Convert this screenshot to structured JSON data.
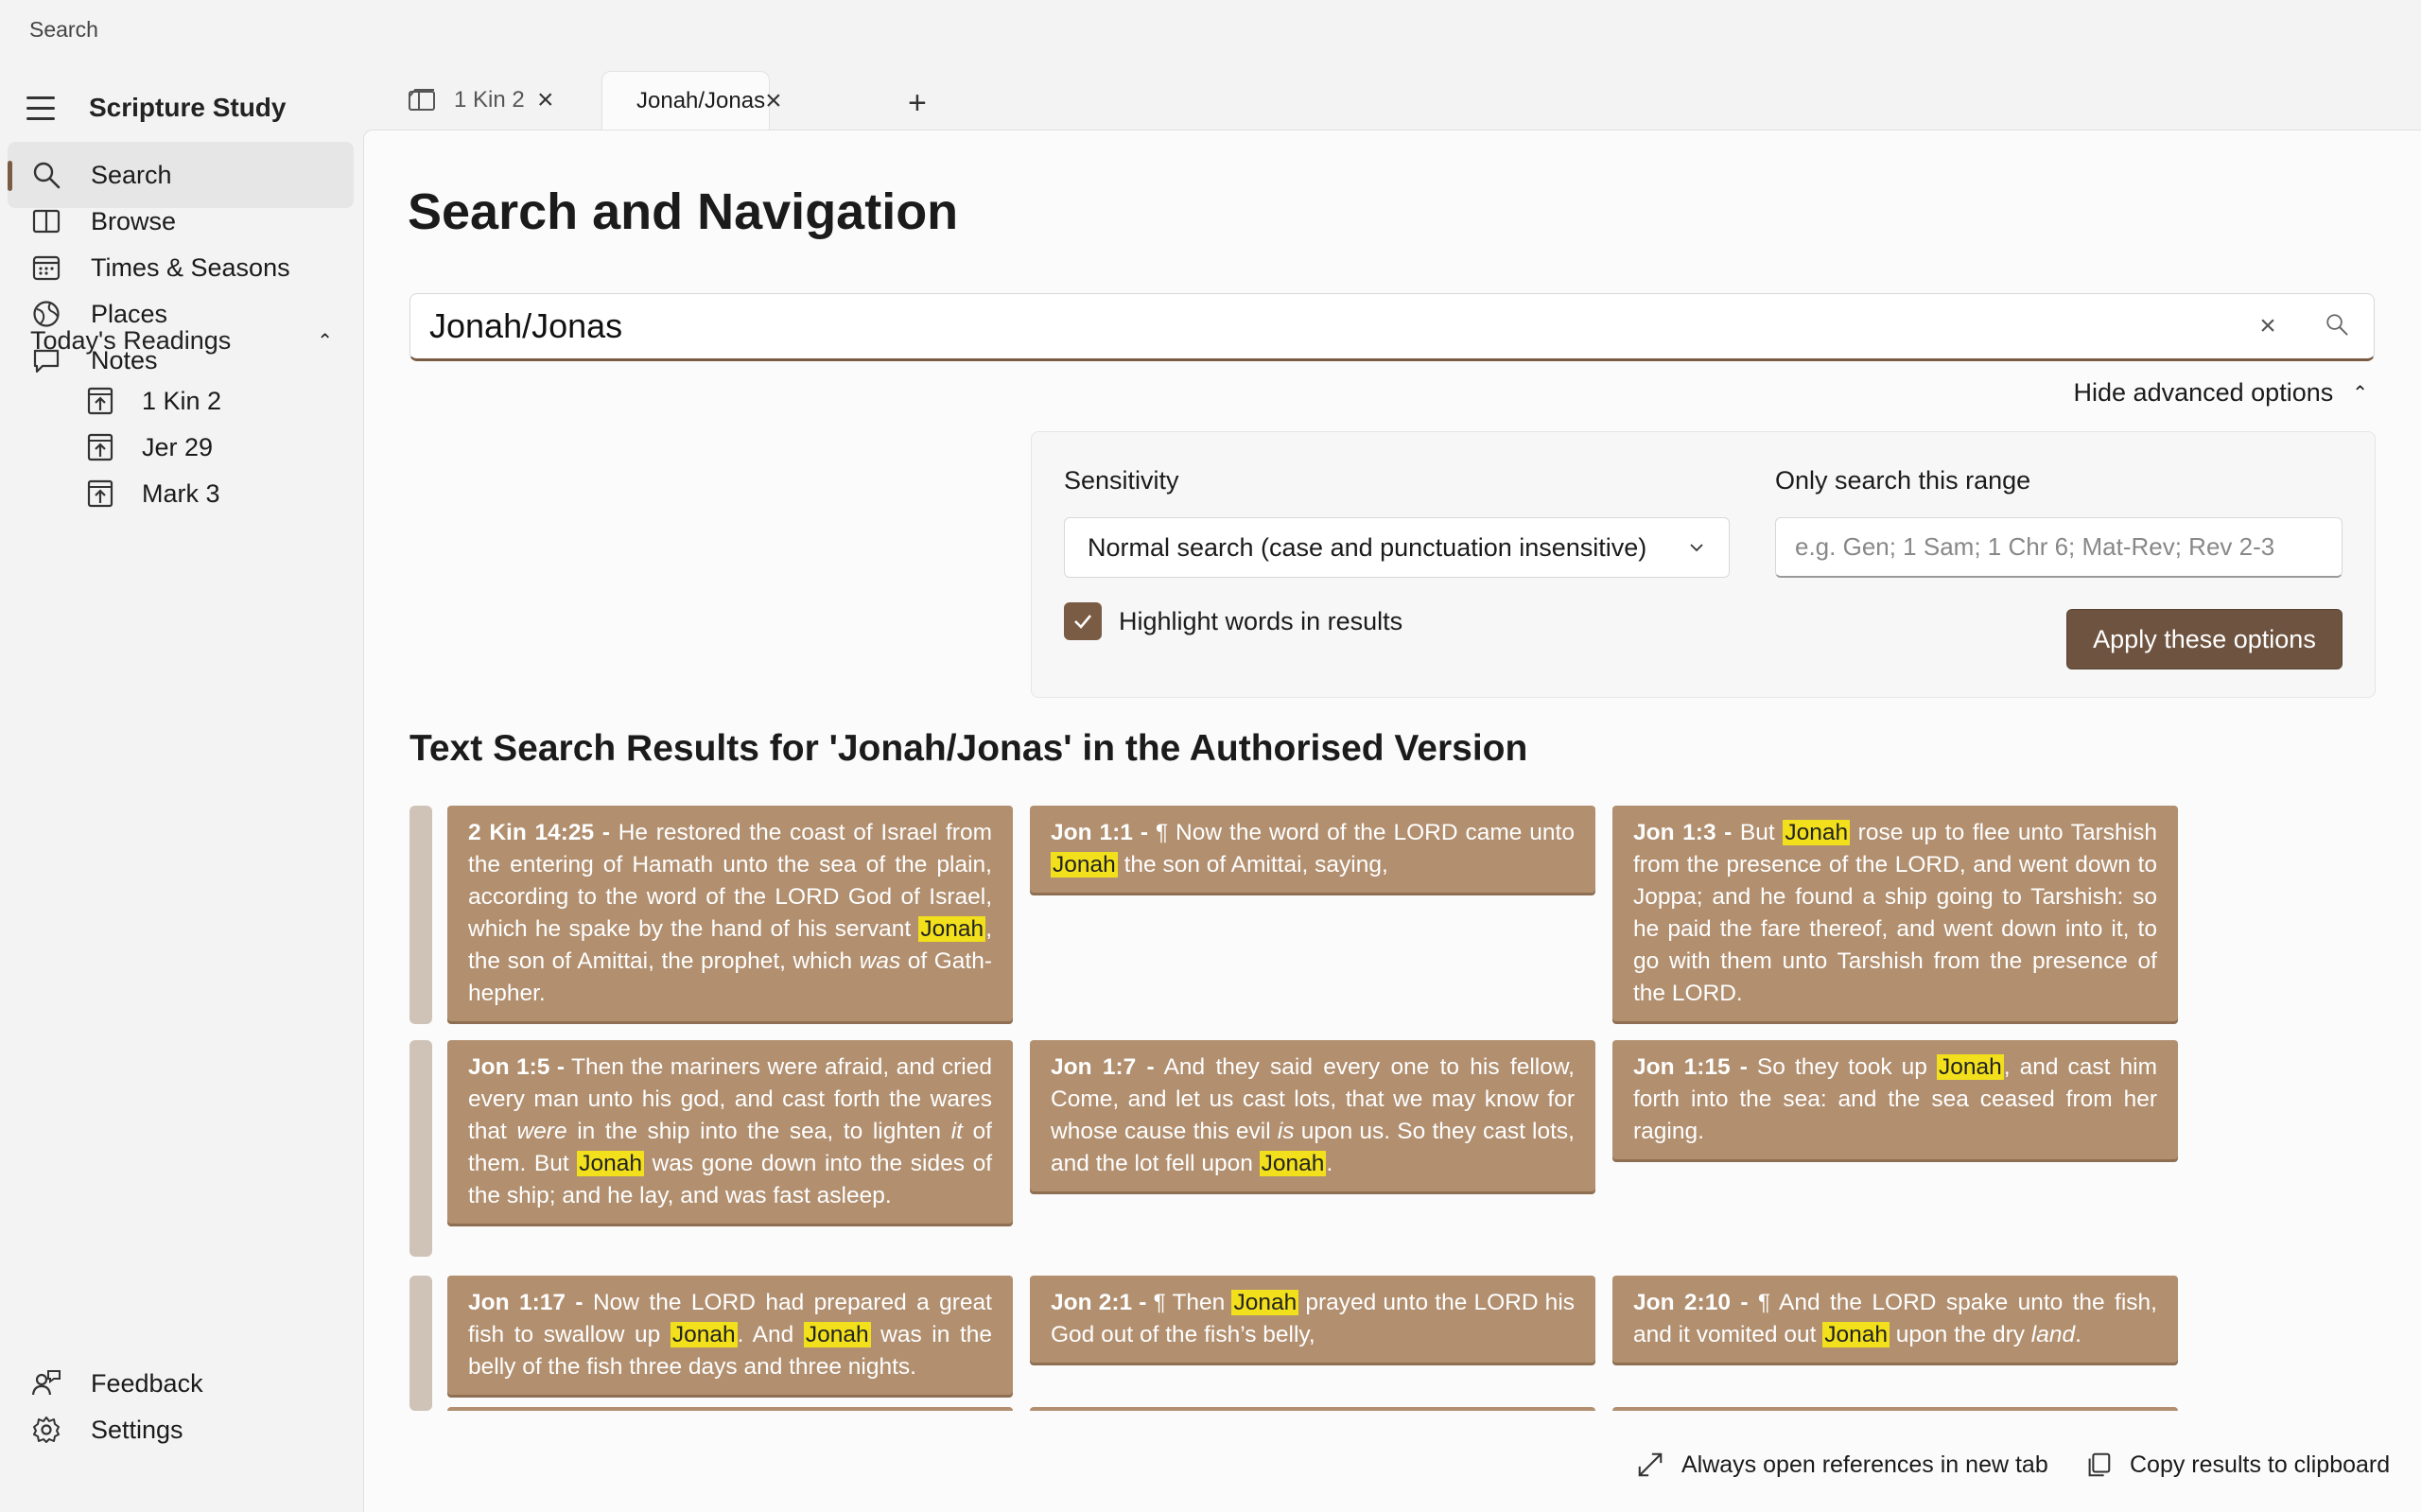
{
  "window": {
    "title": "Search"
  },
  "app": {
    "name": "Scripture Study"
  },
  "nav": {
    "items": [
      {
        "label": "Search",
        "icon": "search-icon"
      },
      {
        "label": "Browse",
        "icon": "book-icon"
      },
      {
        "label": "Times & Seasons",
        "icon": "calendar-icon"
      },
      {
        "label": "Places",
        "icon": "globe-icon"
      },
      {
        "label": "Notes",
        "icon": "comment-icon"
      }
    ],
    "readings_header": "Today's Readings",
    "readings": [
      "1 Kin 2",
      "Jer 29",
      "Mark 3"
    ],
    "feedback": "Feedback",
    "settings": "Settings"
  },
  "tabs": [
    {
      "label": "1 Kin 2",
      "icon": "book-open-icon"
    },
    {
      "label": "Jonah/Jonas",
      "icon": "search-icon"
    }
  ],
  "page": {
    "title": "Search and Navigation"
  },
  "search": {
    "value": "Jonah/Jonas"
  },
  "advanced": {
    "toggle_label": "Hide advanced options",
    "sensitivity_label": "Sensitivity",
    "sensitivity_value": "Normal search (case and punctuation insensitive)",
    "range_label": "Only search this range",
    "range_placeholder": "e.g. Gen; 1 Sam; 1 Chr 6; Mat-Rev; Rev 2-3",
    "highlight_label": "Highlight words in results",
    "highlight_checked": true,
    "apply_label": "Apply these options"
  },
  "results": {
    "title": "Text Search Results for 'Jonah/Jonas' in the Authorised Version",
    "cards": [
      {
        "ref": "2 Kin 14:25 -",
        "segments": [
          {
            "t": " He restored the coast of Israel from the entering of Hamath unto the sea of the plain, according to the word of the LORD God of Israel, which he spake by the hand of his servant "
          },
          {
            "h": "Jonah"
          },
          {
            "t": ", the son of Amittai, the prophet, which "
          },
          {
            "i": "was"
          },
          {
            "t": " of Gath-hepher."
          }
        ]
      },
      {
        "ref": "Jon 1:1 -",
        "segments": [
          {
            "t": " ¶ Now the word of the LORD came unto "
          },
          {
            "h": "Jonah"
          },
          {
            "t": " the son of Amittai, saying,"
          }
        ]
      },
      {
        "ref": "Jon 1:3 -",
        "segments": [
          {
            "t": " But "
          },
          {
            "h": "Jonah"
          },
          {
            "t": " rose up to flee unto Tarshish from the presence of the LORD, and went down to Joppa; and he found a ship going to Tarshish: so he paid the fare thereof, and went down into it, to go with them unto Tarshish from the presence of the LORD."
          }
        ]
      },
      {
        "ref": "Jon 1:5 -",
        "segments": [
          {
            "t": " Then the mariners were afraid, and cried every man unto his god, and cast forth the wares that "
          },
          {
            "i": "were"
          },
          {
            "t": " in the ship into the sea, to lighten "
          },
          {
            "i": "it"
          },
          {
            "t": " of them. But "
          },
          {
            "h": "Jonah"
          },
          {
            "t": " was gone down into the sides of the ship; and he lay, and was fast asleep."
          }
        ]
      },
      {
        "ref": "Jon 1:7 -",
        "segments": [
          {
            "t": " And they said every one to his fellow, Come, and let us cast lots, that we may know for whose cause this evil "
          },
          {
            "i": "is"
          },
          {
            "t": " upon us. So they cast lots, and the lot fell upon "
          },
          {
            "h": "Jonah"
          },
          {
            "t": "."
          }
        ]
      },
      {
        "ref": "Jon 1:15 -",
        "segments": [
          {
            "t": " So they took up "
          },
          {
            "h": "Jonah"
          },
          {
            "t": ", and cast him forth into the sea: and the sea ceased from her raging."
          }
        ]
      },
      {
        "ref": "Jon 1:17 -",
        "segments": [
          {
            "t": " Now the LORD had prepared a great fish to swallow up "
          },
          {
            "h": "Jonah"
          },
          {
            "t": ". And "
          },
          {
            "h": "Jonah"
          },
          {
            "t": " was in the belly of the fish three days and three nights."
          }
        ]
      },
      {
        "ref": "Jon 2:1 -",
        "segments": [
          {
            "t": " ¶ Then "
          },
          {
            "h": "Jonah"
          },
          {
            "t": " prayed unto the LORD his God out of the fish’s belly,"
          }
        ]
      },
      {
        "ref": "Jon 2:10 -",
        "segments": [
          {
            "t": " ¶ And the LORD spake unto the fish, and it vomited out "
          },
          {
            "h": "Jonah"
          },
          {
            "t": " upon the dry "
          },
          {
            "i": "land"
          },
          {
            "t": "."
          }
        ]
      }
    ]
  },
  "footer": {
    "open_new_tab": "Always open references in new tab",
    "copy_results": "Copy results to clipboard"
  },
  "colors": {
    "accent": "#7a5c44",
    "card": "#b18f6f",
    "highlight": "#f3e01c"
  }
}
